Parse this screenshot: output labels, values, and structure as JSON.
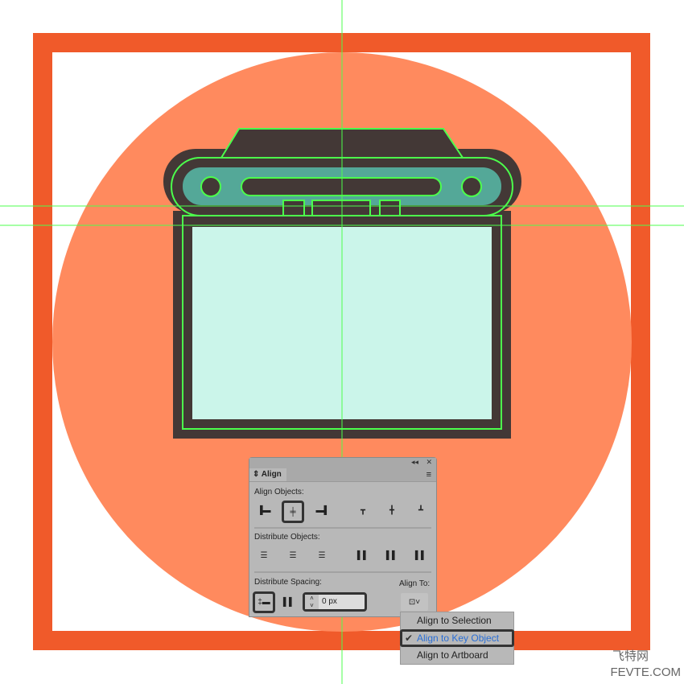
{
  "colors": {
    "frame": "#F05A2A",
    "circle": "#FF8A5E",
    "body": "#433836",
    "screen": "#CBF5EA",
    "teal": "#54A898",
    "guide": "#4cff4c"
  },
  "panel": {
    "title": "Align",
    "collapse_icon": "double-chevron-left-icon",
    "close_icon": "close-icon",
    "align_objects_label": "Align Objects:",
    "distribute_objects_label": "Distribute Objects:",
    "distribute_spacing_label": "Distribute Spacing:",
    "align_to_label": "Align To:",
    "spacing_value": "0 px"
  },
  "dropdown": {
    "items": [
      {
        "label": "Align to Selection",
        "checked": false
      },
      {
        "label": "Align to Key Object",
        "checked": true
      },
      {
        "label": "Align to Artboard",
        "checked": false
      }
    ]
  },
  "watermark": {
    "line1": "飞特网",
    "line2": "FEVTE.COM"
  }
}
